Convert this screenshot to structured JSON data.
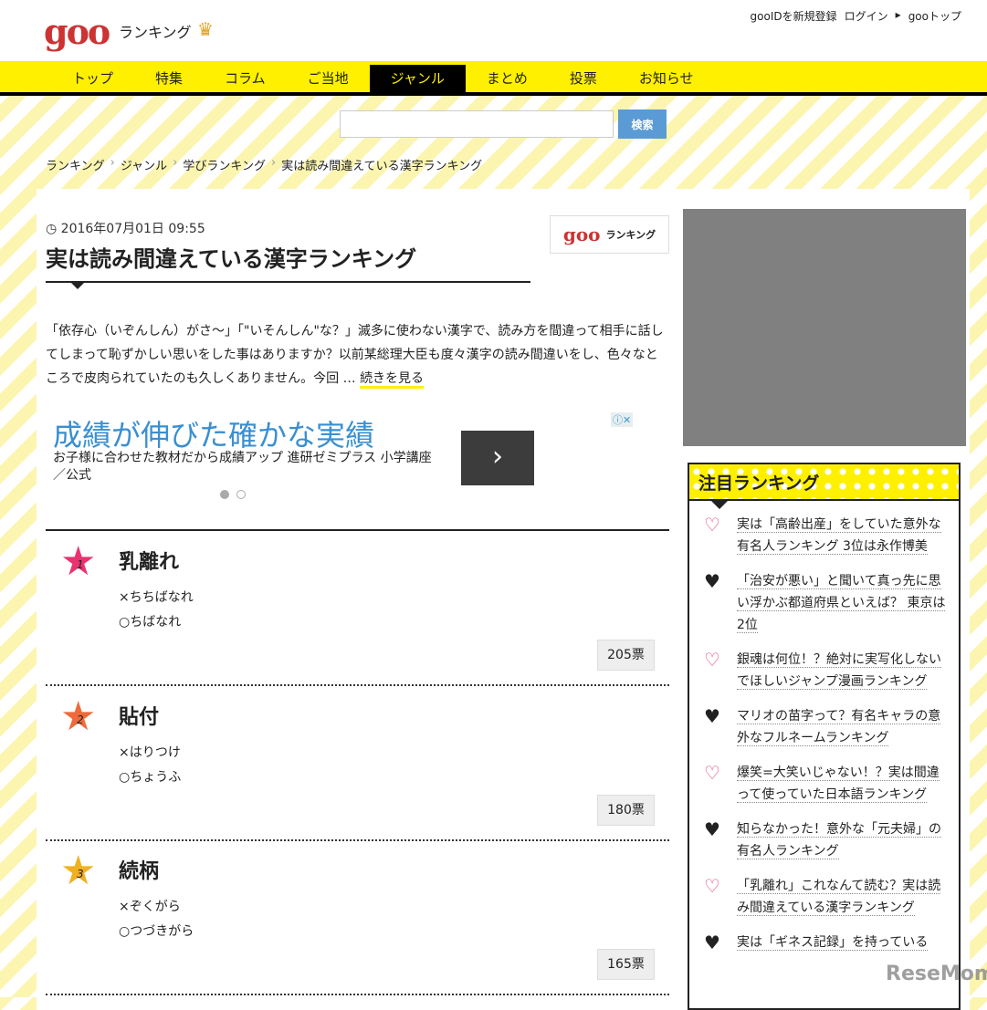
{
  "header": {
    "logo": "goo",
    "logo_sub": "ランキング",
    "links": [
      "gooIDを新規登録",
      "ログイン",
      "gooトップ"
    ]
  },
  "nav": [
    "トップ",
    "特集",
    "コラム",
    "ご当地",
    "ジャンル",
    "まとめ",
    "投票",
    "お知らせ"
  ],
  "search": {
    "value": "",
    "button": "検索"
  },
  "breadcrumb": [
    "ランキング",
    "ジャンル",
    "学びランキング",
    "実は読み間違えている漢字ランキング"
  ],
  "article": {
    "date": "2016年07月01日 09:55",
    "title": "実は読み間違えている漢字ランキング",
    "badge": "ランキング",
    "lead": "「依存心（いぞんしん）がさ～」「\"いそんしん\"な？」滅多に使わない漢字で、読み方を間違って相手に話してしまって恥ずかしい思いをした事はありますか？以前某総理大臣も度々漢字の読み間違いをし、色々なところで皮肉られていたのも久しくありません。今回 … ",
    "more": "続きを見る"
  },
  "ad": {
    "title": "成績が伸びた確かな実績",
    "sub": "お子様に合わせた教材だから成績アップ 進研ゼミプラス 小学講座／公式",
    "arrow": "›",
    "info": "ⓘ✕"
  },
  "ranks": [
    {
      "num": "1",
      "kanji": "乳離れ",
      "wrong": "×ちちばなれ",
      "right": "○ちばなれ",
      "votes": "205票",
      "color": "#e8336f"
    },
    {
      "num": "2",
      "kanji": "貼付",
      "wrong": "×はりつけ",
      "right": "○ちょうふ",
      "votes": "180票",
      "color": "#ee6a3a"
    },
    {
      "num": "3",
      "kanji": "続柄",
      "wrong": "×ぞくがら",
      "right": "○つづきがら",
      "votes": "165票",
      "color": "#f0b020"
    }
  ],
  "sidebar": {
    "title": "注目ランキング",
    "items": [
      "実は「高齢出産」をしていた意外な有名人ランキング 3位は永作博美",
      "「治安が悪い」と聞いて真っ先に思い浮かぶ都道府県といえば？ 東京は2位",
      "銀魂は何位！？絶対に実写化しないでほしいジャンプ漫画ランキング",
      "マリオの苗字って？有名キャラの意外なフルネームランキング",
      "爆笑=大笑いじゃない！？実は間違って使っていた日本語ランキング",
      "知らなかった！意外な「元夫婦」の有名人ランキング",
      "「乳離れ」これなんて読む？実は読み間違えている漢字ランキング",
      "実は「ギネス記録」を持っている"
    ]
  },
  "watermark": "ReseMom"
}
